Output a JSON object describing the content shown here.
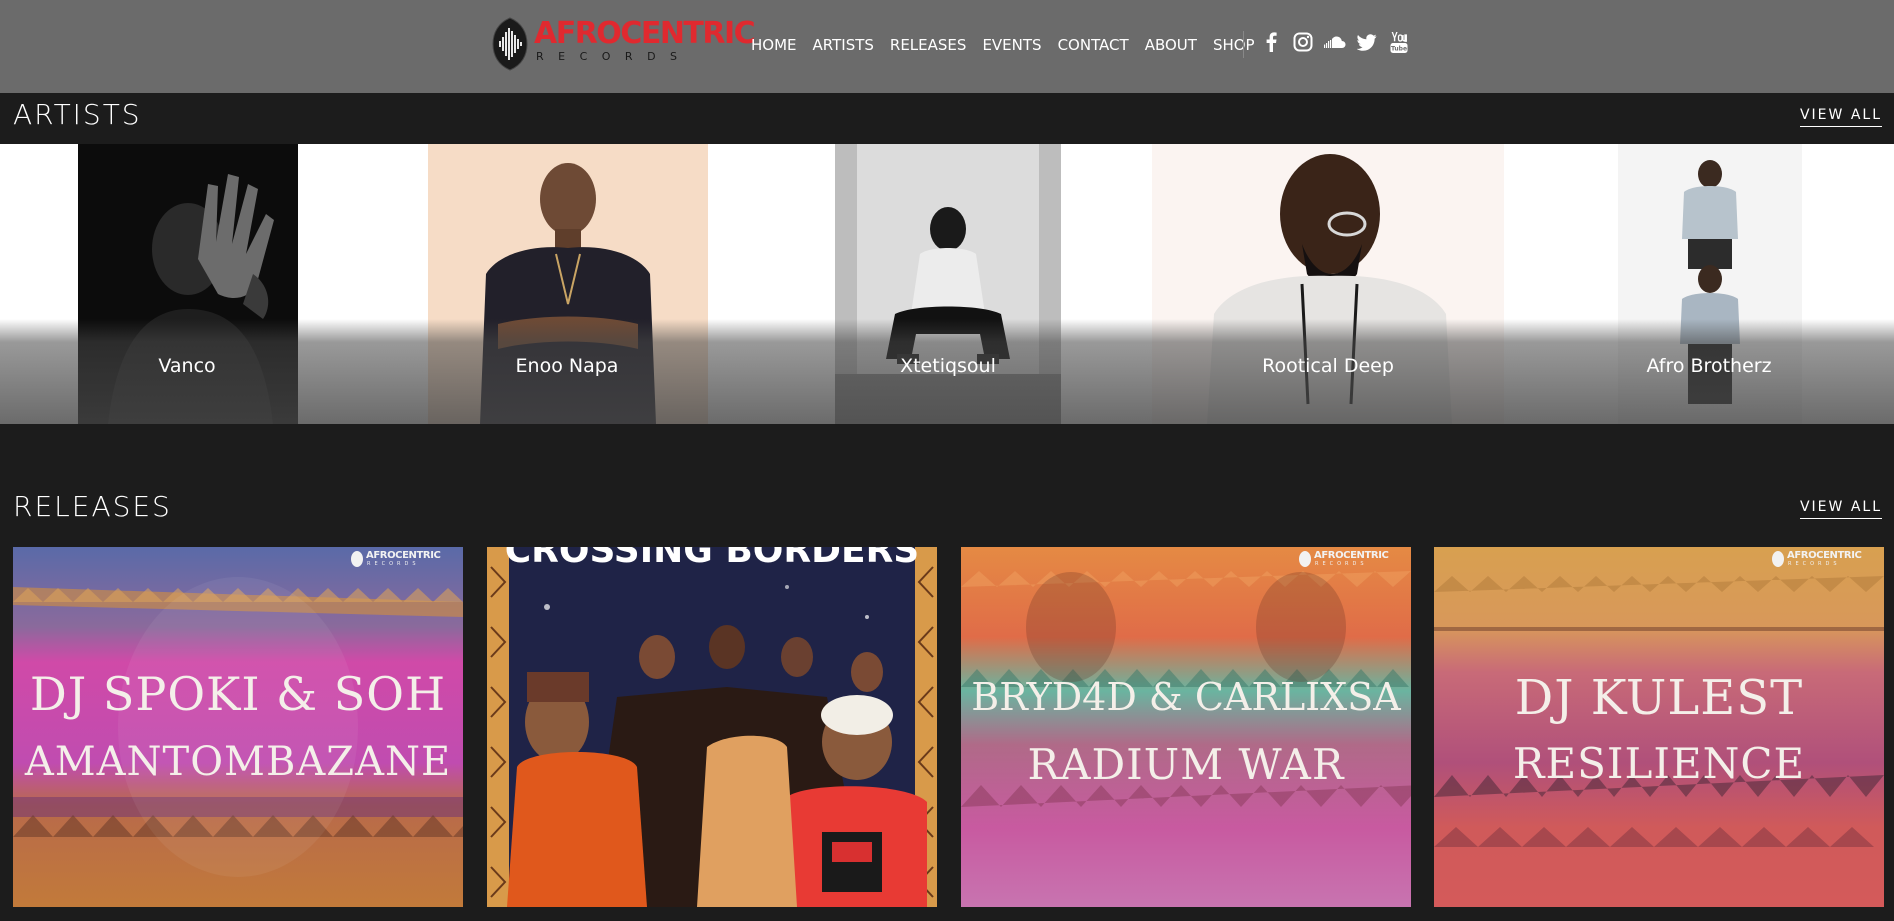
{
  "brand": {
    "name": "AFROCENTRIC",
    "sub": "RECORDS",
    "color": "#e0292f"
  },
  "nav": {
    "items": [
      "HOME",
      "ARTISTS",
      "RELEASES",
      "EVENTS",
      "CONTACT",
      "ABOUT",
      "SHOP"
    ]
  },
  "socials": [
    "facebook-icon",
    "instagram-icon",
    "soundcloud-icon",
    "twitter-icon",
    "youtube-icon"
  ],
  "artists_section": {
    "title": "ARTISTS",
    "view_all": "VIEW ALL",
    "items": [
      {
        "name": "Vanco"
      },
      {
        "name": "Enoo Napa"
      },
      {
        "name": "Xtetiqsoul"
      },
      {
        "name": "Rootical Deep"
      },
      {
        "name": "Afro Brotherz"
      }
    ]
  },
  "releases_section": {
    "title": "RELEASES",
    "view_all": "VIEW ALL",
    "items": [
      {
        "artist": "DJ SPOKI & SOH",
        "title": "AMANTOMBAZANE"
      },
      {
        "artist": "",
        "title": "CROSSING BÖRDERS"
      },
      {
        "artist": "BRYD4D & CARLIXSA",
        "title": "RADIUM WAR"
      },
      {
        "artist": "DJ KULEST",
        "title": "RESILIENCE"
      }
    ],
    "cover_label": {
      "word": "AFROCENTRIC",
      "sub": "RECORDS"
    }
  }
}
